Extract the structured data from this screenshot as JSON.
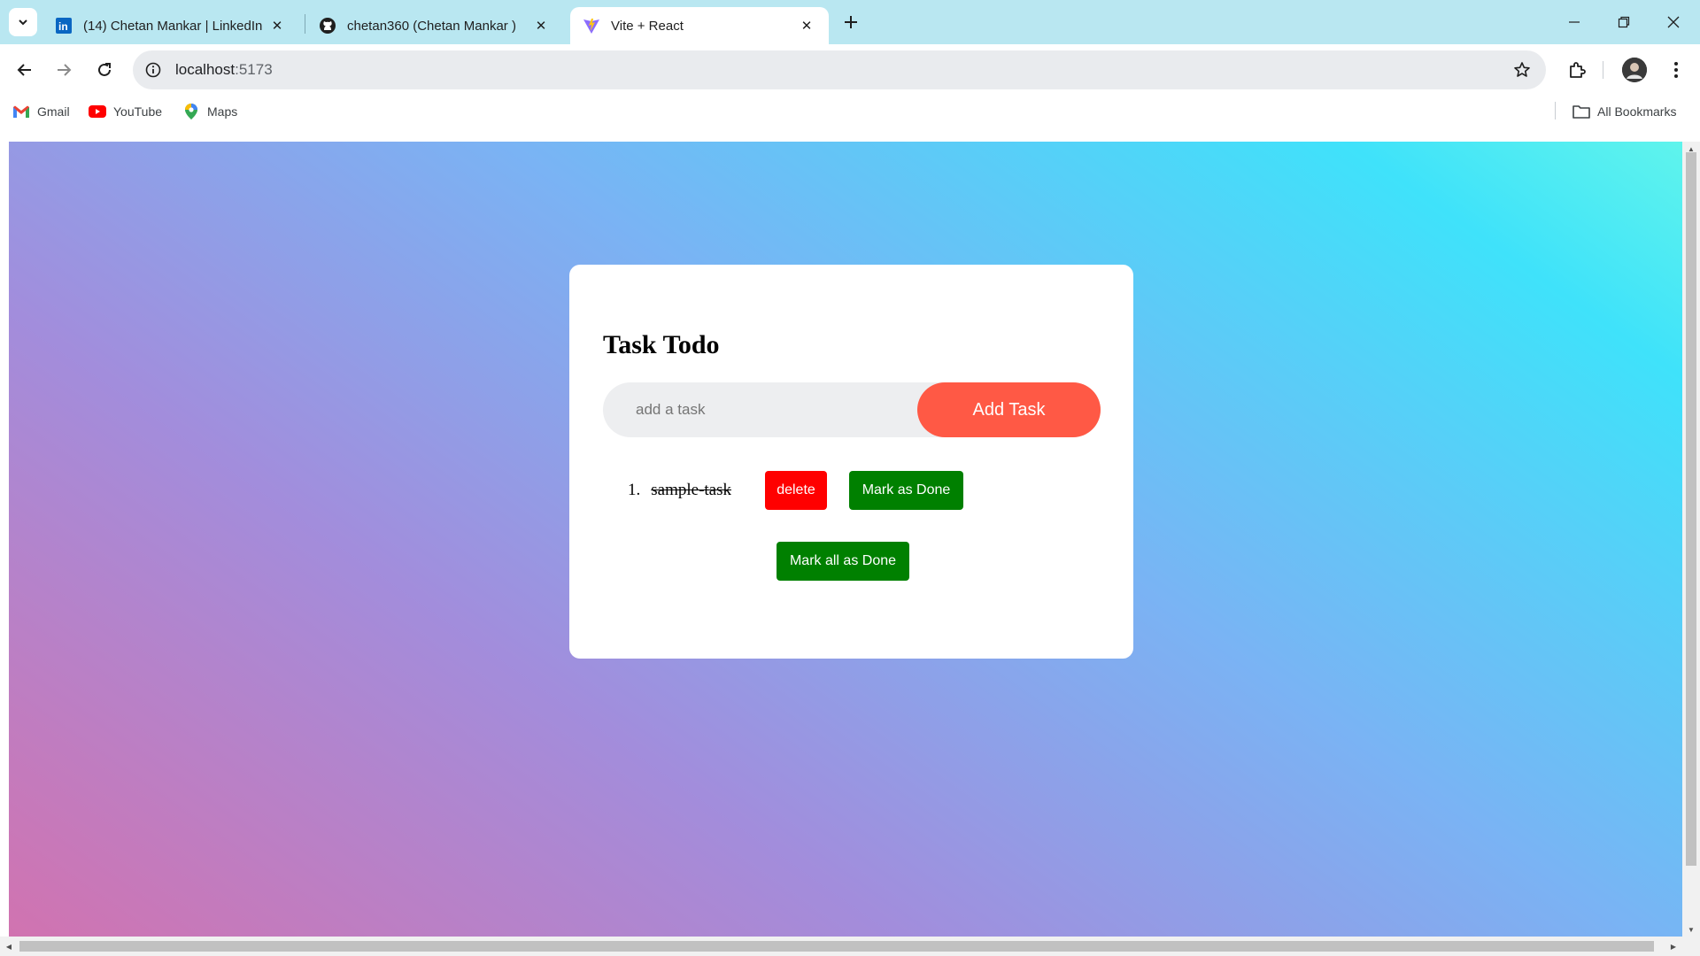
{
  "browser": {
    "tabs": [
      {
        "title": "(14) Chetan Mankar | LinkedIn",
        "icon": "linkedin-icon",
        "active": false
      },
      {
        "title": "chetan360 (Chetan Mankar )",
        "icon": "github-icon",
        "active": false
      },
      {
        "title": "Vite + React",
        "icon": "vite-icon",
        "active": true
      }
    ],
    "address": {
      "host": "localhost",
      "port": ":5173"
    },
    "bookmarks": [
      {
        "label": "Gmail",
        "icon": "gmail-icon"
      },
      {
        "label": "YouTube",
        "icon": "youtube-icon"
      },
      {
        "label": "Maps",
        "icon": "maps-icon"
      }
    ],
    "all_bookmarks_label": "All Bookmarks"
  },
  "app": {
    "title": "Task Todo",
    "input": {
      "placeholder": "add a task",
      "value": ""
    },
    "add_button_label": "Add Task",
    "tasks": [
      {
        "number": "1.",
        "text": "sample-task",
        "done": true,
        "delete_label": "delete",
        "done_label": "Mark as Done"
      }
    ],
    "mark_all_label": "Mark all as Done"
  },
  "colors": {
    "add_button": "#ff5945",
    "delete_button": "#ff0000",
    "done_button": "#008000",
    "tabstrip": "#b9e7f1",
    "gradient_start": "#d173b0",
    "gradient_end": "#5ff4ec"
  }
}
